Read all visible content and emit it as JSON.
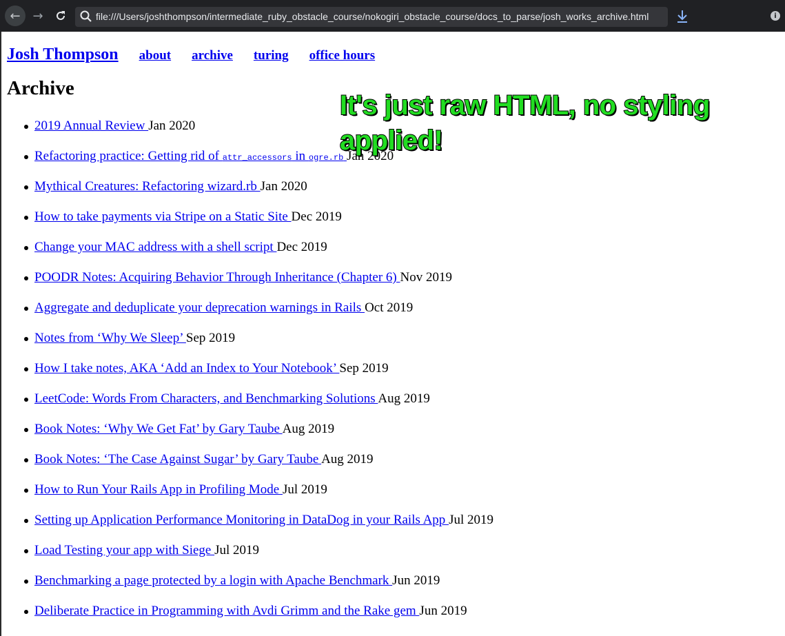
{
  "browser": {
    "url": "file:///Users/joshthompson/intermediate_ruby_obstacle_course/nokogiri_obstacle_course/docs_to_parse/josh_works_archive.html",
    "back_icon": "arrow-left-icon",
    "forward_icon": "arrow-right-icon",
    "reload_icon": "reload-icon",
    "search_icon": "search-icon",
    "download_icon": "download-icon",
    "info_icon": "info-icon"
  },
  "site": {
    "title": "Josh Thompson",
    "nav": [
      "about",
      "archive",
      "turing",
      "office hours"
    ]
  },
  "page": {
    "heading": "Archive"
  },
  "posts": [
    {
      "title": "2019 Annual Review ",
      "date": "Jan 2020"
    },
    {
      "title_parts": [
        "Refactoring practice: Getting rid of ",
        "attr_accessors",
        " in ",
        "ogre.rb",
        " "
      ],
      "date": "Jan 2020"
    },
    {
      "title": "Mythical Creatures: Refactoring wizard.rb ",
      "date": "Jan 2020"
    },
    {
      "title": "How to take payments via Stripe on a Static Site ",
      "date": "Dec 2019"
    },
    {
      "title": "Change your MAC address with a shell script ",
      "date": "Dec 2019"
    },
    {
      "title": "POODR Notes: Acquiring Behavior Through Inheritance (Chapter 6) ",
      "date": "Nov 2019"
    },
    {
      "title": "Aggregate and deduplicate your deprecation warnings in Rails ",
      "date": "Oct 2019"
    },
    {
      "title": "Notes from ‘Why We Sleep’ ",
      "date": "Sep 2019"
    },
    {
      "title": "How I take notes, AKA ‘Add an Index to Your Notebook’ ",
      "date": "Sep 2019"
    },
    {
      "title": "LeetCode: Words From Characters, and Benchmarking Solutions ",
      "date": "Aug 2019"
    },
    {
      "title": "Book Notes: ‘Why We Get Fat’ by Gary Taube ",
      "date": "Aug 2019"
    },
    {
      "title": "Book Notes: ‘The Case Against Sugar’ by Gary Taube ",
      "date": "Aug 2019"
    },
    {
      "title": "How to Run Your Rails App in Profiling Mode ",
      "date": "Jul 2019"
    },
    {
      "title": "Setting up Application Performance Monitoring in DataDog in your Rails App ",
      "date": "Jul 2019"
    },
    {
      "title": "Load Testing your app with Siege ",
      "date": "Jul 2019"
    },
    {
      "title": "Benchmarking a page protected by a login with Apache Benchmark ",
      "date": "Jun 2019"
    },
    {
      "title": "Deliberate Practice in Programming with Avdi Grimm and the Rake gem ",
      "date": "Jun 2019"
    }
  ],
  "annotation": {
    "text": "It's just raw HTML, no styling applied!",
    "color": "#22dd22"
  }
}
